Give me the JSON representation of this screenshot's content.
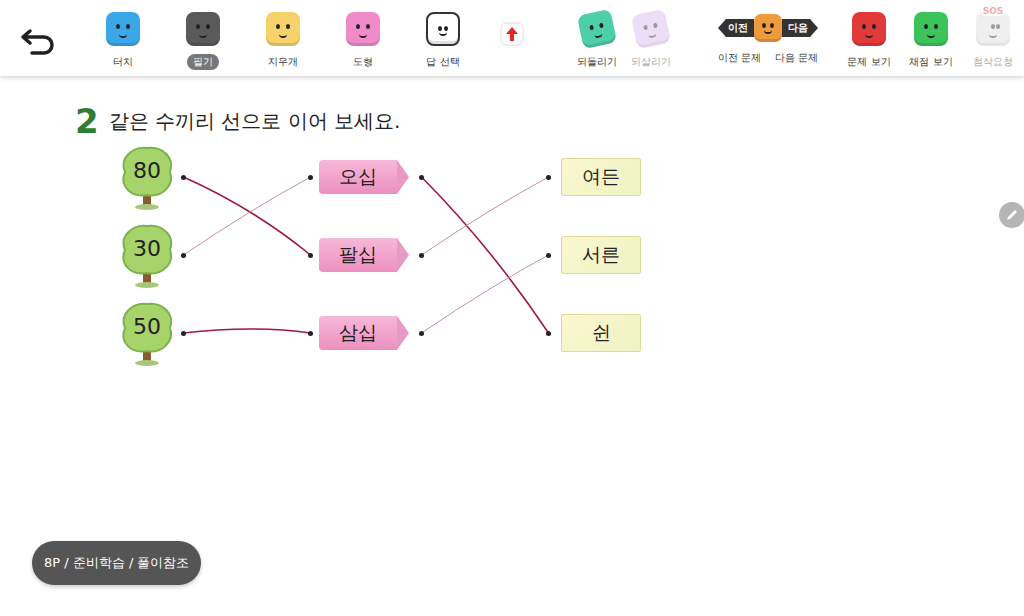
{
  "toolbar": {
    "left_tools": [
      {
        "label": "터치",
        "selected": false,
        "disabled": false,
        "color": "#3aa8e8"
      },
      {
        "label": "필기",
        "selected": true,
        "disabled": false,
        "color": "#5a5a5a"
      },
      {
        "label": "지우개",
        "selected": false,
        "disabled": false,
        "color": "#f5d36a"
      },
      {
        "label": "도형",
        "selected": false,
        "disabled": false,
        "color": "#f08ac8"
      },
      {
        "label": "답 선택",
        "selected": false,
        "disabled": false,
        "color": "#ffffff"
      }
    ],
    "history_tools": [
      {
        "label": "되돌리기",
        "selected": false,
        "disabled": false,
        "color": "#4fcfa8"
      },
      {
        "label": "되살리기",
        "selected": false,
        "disabled": true,
        "color": "#d9b8ee"
      }
    ],
    "nav": {
      "prev_badge": "이전",
      "next_badge": "다음",
      "prev_label": "이전 문제",
      "next_label": "다음 문제"
    },
    "end_tools": [
      {
        "label": "문제 보기",
        "selected": false,
        "disabled": false,
        "color": "#e23a3a",
        "badge": ""
      },
      {
        "label": "채점 보기",
        "selected": false,
        "disabled": false,
        "color": "#3cc45a",
        "badge": ""
      },
      {
        "label": "첨삭요청",
        "selected": false,
        "disabled": true,
        "color": "#dddddd",
        "badge": "SOS"
      }
    ]
  },
  "question": {
    "number": "2",
    "instruction": "같은 수끼리 선으로 이어 보세요."
  },
  "matching": {
    "left": [
      "80",
      "30",
      "50"
    ],
    "middle": [
      "오십",
      "팔십",
      "삼십"
    ],
    "right": [
      "여든",
      "서른",
      "쉰"
    ],
    "lines": [
      {
        "from": "80",
        "to": "팔십",
        "faint": false
      },
      {
        "from": "30",
        "to": "오십",
        "faint": true
      },
      {
        "from": "50",
        "to": "삼십",
        "faint": false
      },
      {
        "from": "오십",
        "to": "쉰",
        "faint": false
      },
      {
        "from": "팔십",
        "to": "여든",
        "faint": true
      },
      {
        "from": "삼십",
        "to": "서른",
        "faint": true
      }
    ]
  },
  "footer": {
    "breadcrumb": "8P / 준비학습 / 풀이참조"
  }
}
